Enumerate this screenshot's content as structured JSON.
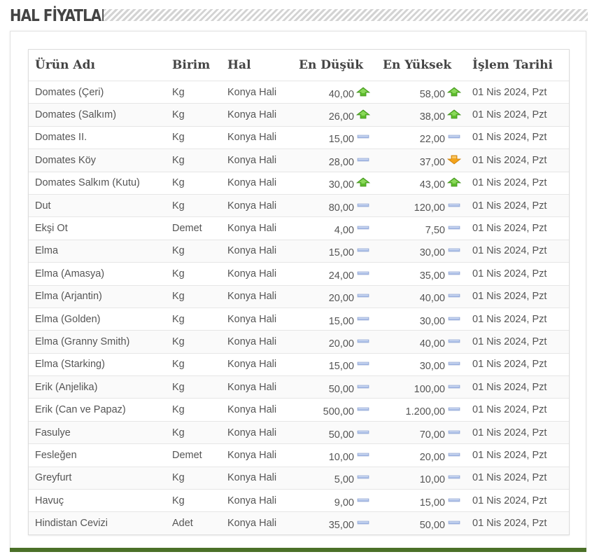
{
  "title": "HAL FİYATLARI",
  "colors": {
    "accent_bar": "#4b7028",
    "up": "#5dbb2c",
    "down": "#f3a31a",
    "same": "#a9bde6"
  },
  "columns": {
    "name": "Ürün Adı",
    "unit": "Birim",
    "hal": "Hal",
    "min": "En Düşük",
    "max": "En Yüksek",
    "date": "İşlem Tarihi"
  },
  "rows": [
    {
      "name": "Domates (Çeri)",
      "unit": "Kg",
      "hal": "Konya Hali",
      "min": "40,00",
      "min_trend": "up",
      "max": "58,00",
      "max_trend": "up",
      "date": "01 Nis 2024, Pzt"
    },
    {
      "name": "Domates (Salkım)",
      "unit": "Kg",
      "hal": "Konya Hali",
      "min": "26,00",
      "min_trend": "up",
      "max": "38,00",
      "max_trend": "up",
      "date": "01 Nis 2024, Pzt"
    },
    {
      "name": "Domates II.",
      "unit": "Kg",
      "hal": "Konya Hali",
      "min": "15,00",
      "min_trend": "same",
      "max": "22,00",
      "max_trend": "same",
      "date": "01 Nis 2024, Pzt"
    },
    {
      "name": "Domates Köy",
      "unit": "Kg",
      "hal": "Konya Hali",
      "min": "28,00",
      "min_trend": "same",
      "max": "37,00",
      "max_trend": "down",
      "date": "01 Nis 2024, Pzt"
    },
    {
      "name": "Domates Salkım (Kutu)",
      "unit": "Kg",
      "hal": "Konya Hali",
      "min": "30,00",
      "min_trend": "up",
      "max": "43,00",
      "max_trend": "up",
      "date": "01 Nis 2024, Pzt"
    },
    {
      "name": "Dut",
      "unit": "Kg",
      "hal": "Konya Hali",
      "min": "80,00",
      "min_trend": "same",
      "max": "120,00",
      "max_trend": "same",
      "date": "01 Nis 2024, Pzt"
    },
    {
      "name": "Ekşi Ot",
      "unit": "Demet",
      "hal": "Konya Hali",
      "min": "4,00",
      "min_trend": "same",
      "max": "7,50",
      "max_trend": "same",
      "date": "01 Nis 2024, Pzt"
    },
    {
      "name": "Elma",
      "unit": "Kg",
      "hal": "Konya Hali",
      "min": "15,00",
      "min_trend": "same",
      "max": "30,00",
      "max_trend": "same",
      "date": "01 Nis 2024, Pzt"
    },
    {
      "name": "Elma (Amasya)",
      "unit": "Kg",
      "hal": "Konya Hali",
      "min": "24,00",
      "min_trend": "same",
      "max": "35,00",
      "max_trend": "same",
      "date": "01 Nis 2024, Pzt"
    },
    {
      "name": "Elma (Arjantin)",
      "unit": "Kg",
      "hal": "Konya Hali",
      "min": "20,00",
      "min_trend": "same",
      "max": "40,00",
      "max_trend": "same",
      "date": "01 Nis 2024, Pzt"
    },
    {
      "name": "Elma (Golden)",
      "unit": "Kg",
      "hal": "Konya Hali",
      "min": "15,00",
      "min_trend": "same",
      "max": "30,00",
      "max_trend": "same",
      "date": "01 Nis 2024, Pzt"
    },
    {
      "name": "Elma (Granny Smith)",
      "unit": "Kg",
      "hal": "Konya Hali",
      "min": "20,00",
      "min_trend": "same",
      "max": "40,00",
      "max_trend": "same",
      "date": "01 Nis 2024, Pzt"
    },
    {
      "name": "Elma (Starking)",
      "unit": "Kg",
      "hal": "Konya Hali",
      "min": "15,00",
      "min_trend": "same",
      "max": "30,00",
      "max_trend": "same",
      "date": "01 Nis 2024, Pzt"
    },
    {
      "name": "Erik (Anjelika)",
      "unit": "Kg",
      "hal": "Konya Hali",
      "min": "50,00",
      "min_trend": "same",
      "max": "100,00",
      "max_trend": "same",
      "date": "01 Nis 2024, Pzt"
    },
    {
      "name": "Erik (Can ve Papaz)",
      "unit": "Kg",
      "hal": "Konya Hali",
      "min": "500,00",
      "min_trend": "same",
      "max": "1.200,00",
      "max_trend": "same",
      "date": "01 Nis 2024, Pzt"
    },
    {
      "name": "Fasulye",
      "unit": "Kg",
      "hal": "Konya Hali",
      "min": "50,00",
      "min_trend": "same",
      "max": "70,00",
      "max_trend": "same",
      "date": "01 Nis 2024, Pzt"
    },
    {
      "name": "Fesleğen",
      "unit": "Demet",
      "hal": "Konya Hali",
      "min": "10,00",
      "min_trend": "same",
      "max": "20,00",
      "max_trend": "same",
      "date": "01 Nis 2024, Pzt"
    },
    {
      "name": "Greyfurt",
      "unit": "Kg",
      "hal": "Konya Hali",
      "min": "5,00",
      "min_trend": "same",
      "max": "10,00",
      "max_trend": "same",
      "date": "01 Nis 2024, Pzt"
    },
    {
      "name": "Havuç",
      "unit": "Kg",
      "hal": "Konya Hali",
      "min": "9,00",
      "min_trend": "same",
      "max": "15,00",
      "max_trend": "same",
      "date": "01 Nis 2024, Pzt"
    },
    {
      "name": "Hindistan Cevizi",
      "unit": "Adet",
      "hal": "Konya Hali",
      "min": "35,00",
      "min_trend": "same",
      "max": "50,00",
      "max_trend": "same",
      "date": "01 Nis 2024, Pzt"
    }
  ]
}
